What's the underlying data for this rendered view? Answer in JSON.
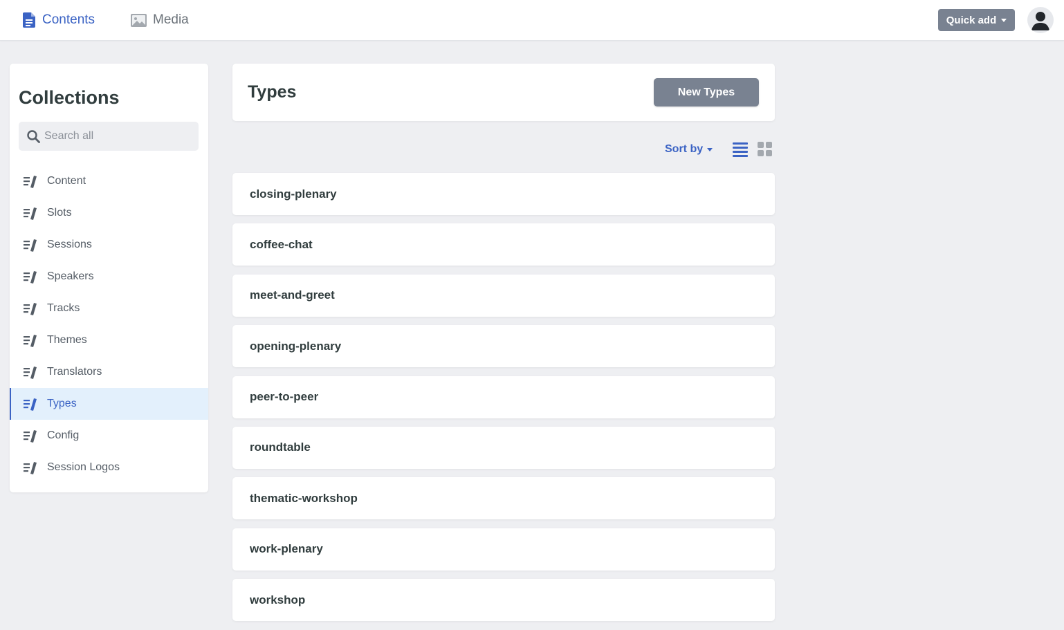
{
  "topnav": {
    "tabs": [
      {
        "label": "Contents",
        "icon": "document-icon",
        "active": true
      },
      {
        "label": "Media",
        "icon": "image-icon",
        "active": false
      }
    ],
    "quick_add_label": "Quick add"
  },
  "sidebar": {
    "title": "Collections",
    "search_placeholder": "Search all",
    "items": [
      {
        "label": "Content"
      },
      {
        "label": "Slots"
      },
      {
        "label": "Sessions"
      },
      {
        "label": "Speakers"
      },
      {
        "label": "Tracks"
      },
      {
        "label": "Themes"
      },
      {
        "label": "Translators"
      },
      {
        "label": "Types",
        "active": true
      },
      {
        "label": "Config"
      },
      {
        "label": "Session Logos"
      }
    ]
  },
  "main": {
    "title": "Types",
    "new_button_label": "New Types",
    "sort_label": "Sort by",
    "view_mode": "list",
    "entries": [
      "closing-plenary",
      "coffee-chat",
      "meet-and-greet",
      "opening-plenary",
      "peer-to-peer",
      "roundtable",
      "thematic-workshop",
      "work-plenary",
      "workshop"
    ]
  },
  "colors": {
    "accent": "#3b63c4",
    "button_gray": "#798291",
    "background": "#eeeff2",
    "active_item_bg": "#e3f0fc"
  }
}
